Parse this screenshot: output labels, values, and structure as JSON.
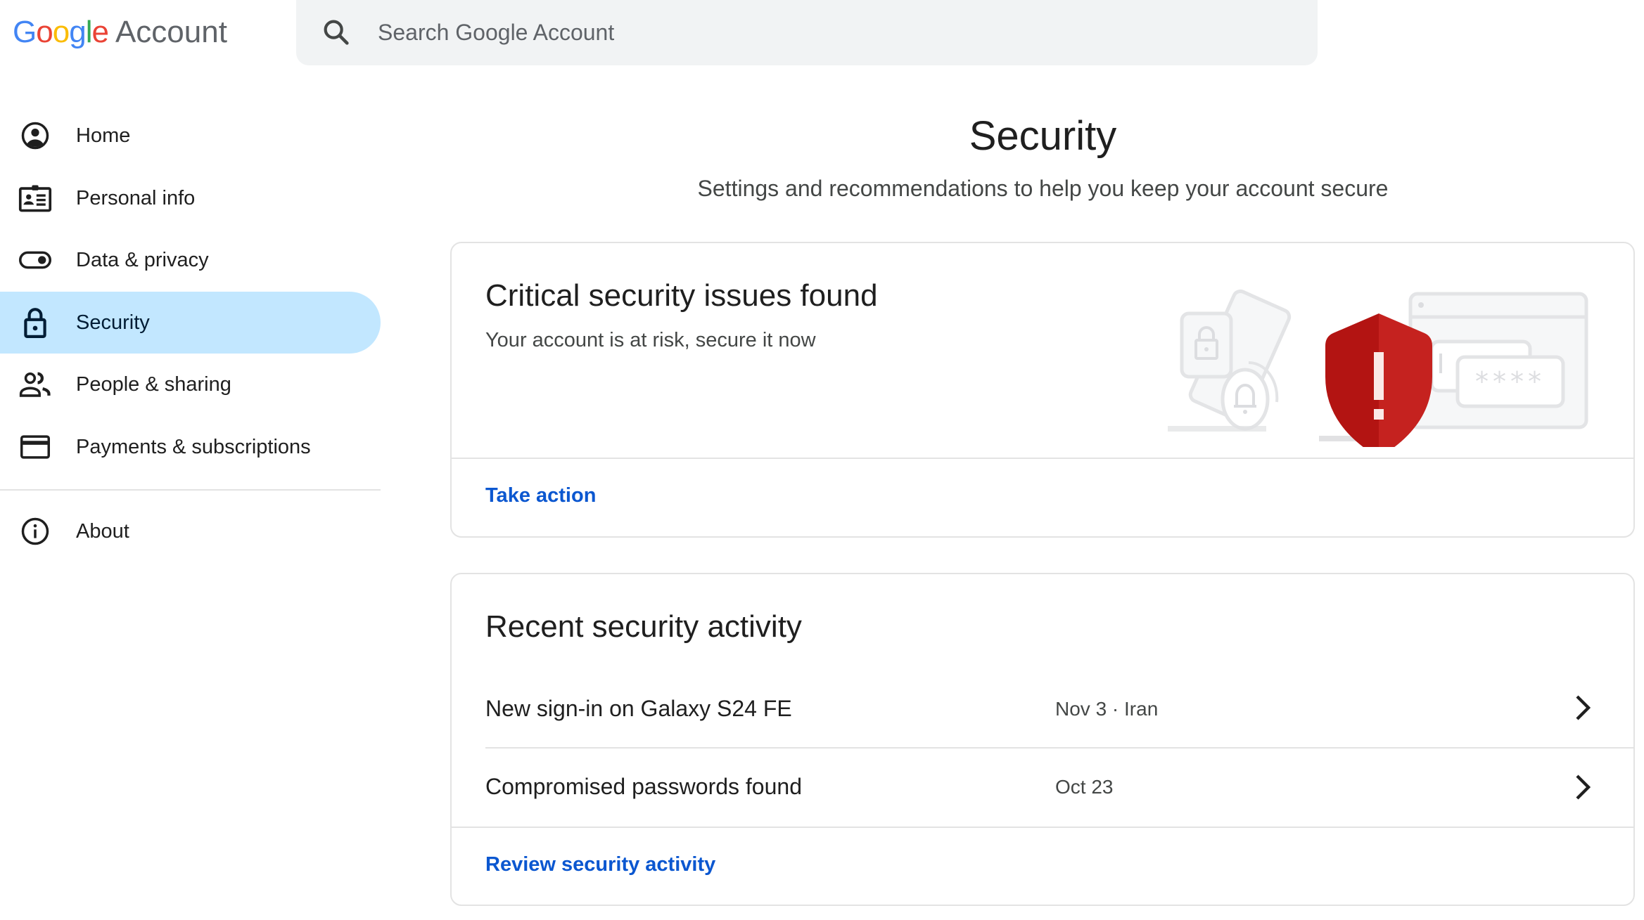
{
  "header": {
    "logo": {
      "google_letters": [
        {
          "ch": "G",
          "color": "#4285f4"
        },
        {
          "ch": "o",
          "color": "#ea4335"
        },
        {
          "ch": "o",
          "color": "#fbbc05"
        },
        {
          "ch": "g",
          "color": "#4285f4"
        },
        {
          "ch": "l",
          "color": "#34a853"
        },
        {
          "ch": "e",
          "color": "#ea4335"
        }
      ],
      "product": "Account"
    },
    "search": {
      "placeholder": "Search Google Account",
      "value": "",
      "icon": "search-icon"
    }
  },
  "sidebar": {
    "items": [
      {
        "label": "Home",
        "icon": "account-circle-icon",
        "active": false
      },
      {
        "label": "Personal info",
        "icon": "id-card-icon",
        "active": false
      },
      {
        "label": "Data & privacy",
        "icon": "toggle-icon",
        "active": false
      },
      {
        "label": "Security",
        "icon": "lock-icon",
        "active": true
      },
      {
        "label": "People & sharing",
        "icon": "people-icon",
        "active": false
      },
      {
        "label": "Payments & subscriptions",
        "icon": "credit-card-icon",
        "active": false
      }
    ],
    "footer_items": [
      {
        "label": "About",
        "icon": "info-icon"
      }
    ],
    "active_color": "#c2e7ff"
  },
  "main": {
    "title": "Security",
    "subtitle": "Settings and recommendations to help you keep your account secure",
    "alert_card": {
      "title": "Critical security issues found",
      "description": "Your account is at risk, secure it now",
      "action_label": "Take action",
      "illustration": "security-warning-shield-illustration",
      "shield_color": "#c5221f"
    },
    "activity_card": {
      "title": "Recent security activity",
      "rows": [
        {
          "title": "New sign-in on Galaxy S24 FE",
          "meta": "Nov 3 · Iran"
        },
        {
          "title": "Compromised passwords found",
          "meta": "Oct 23"
        }
      ],
      "footer_link": "Review security activity"
    },
    "link_color": "#0b57d0"
  }
}
